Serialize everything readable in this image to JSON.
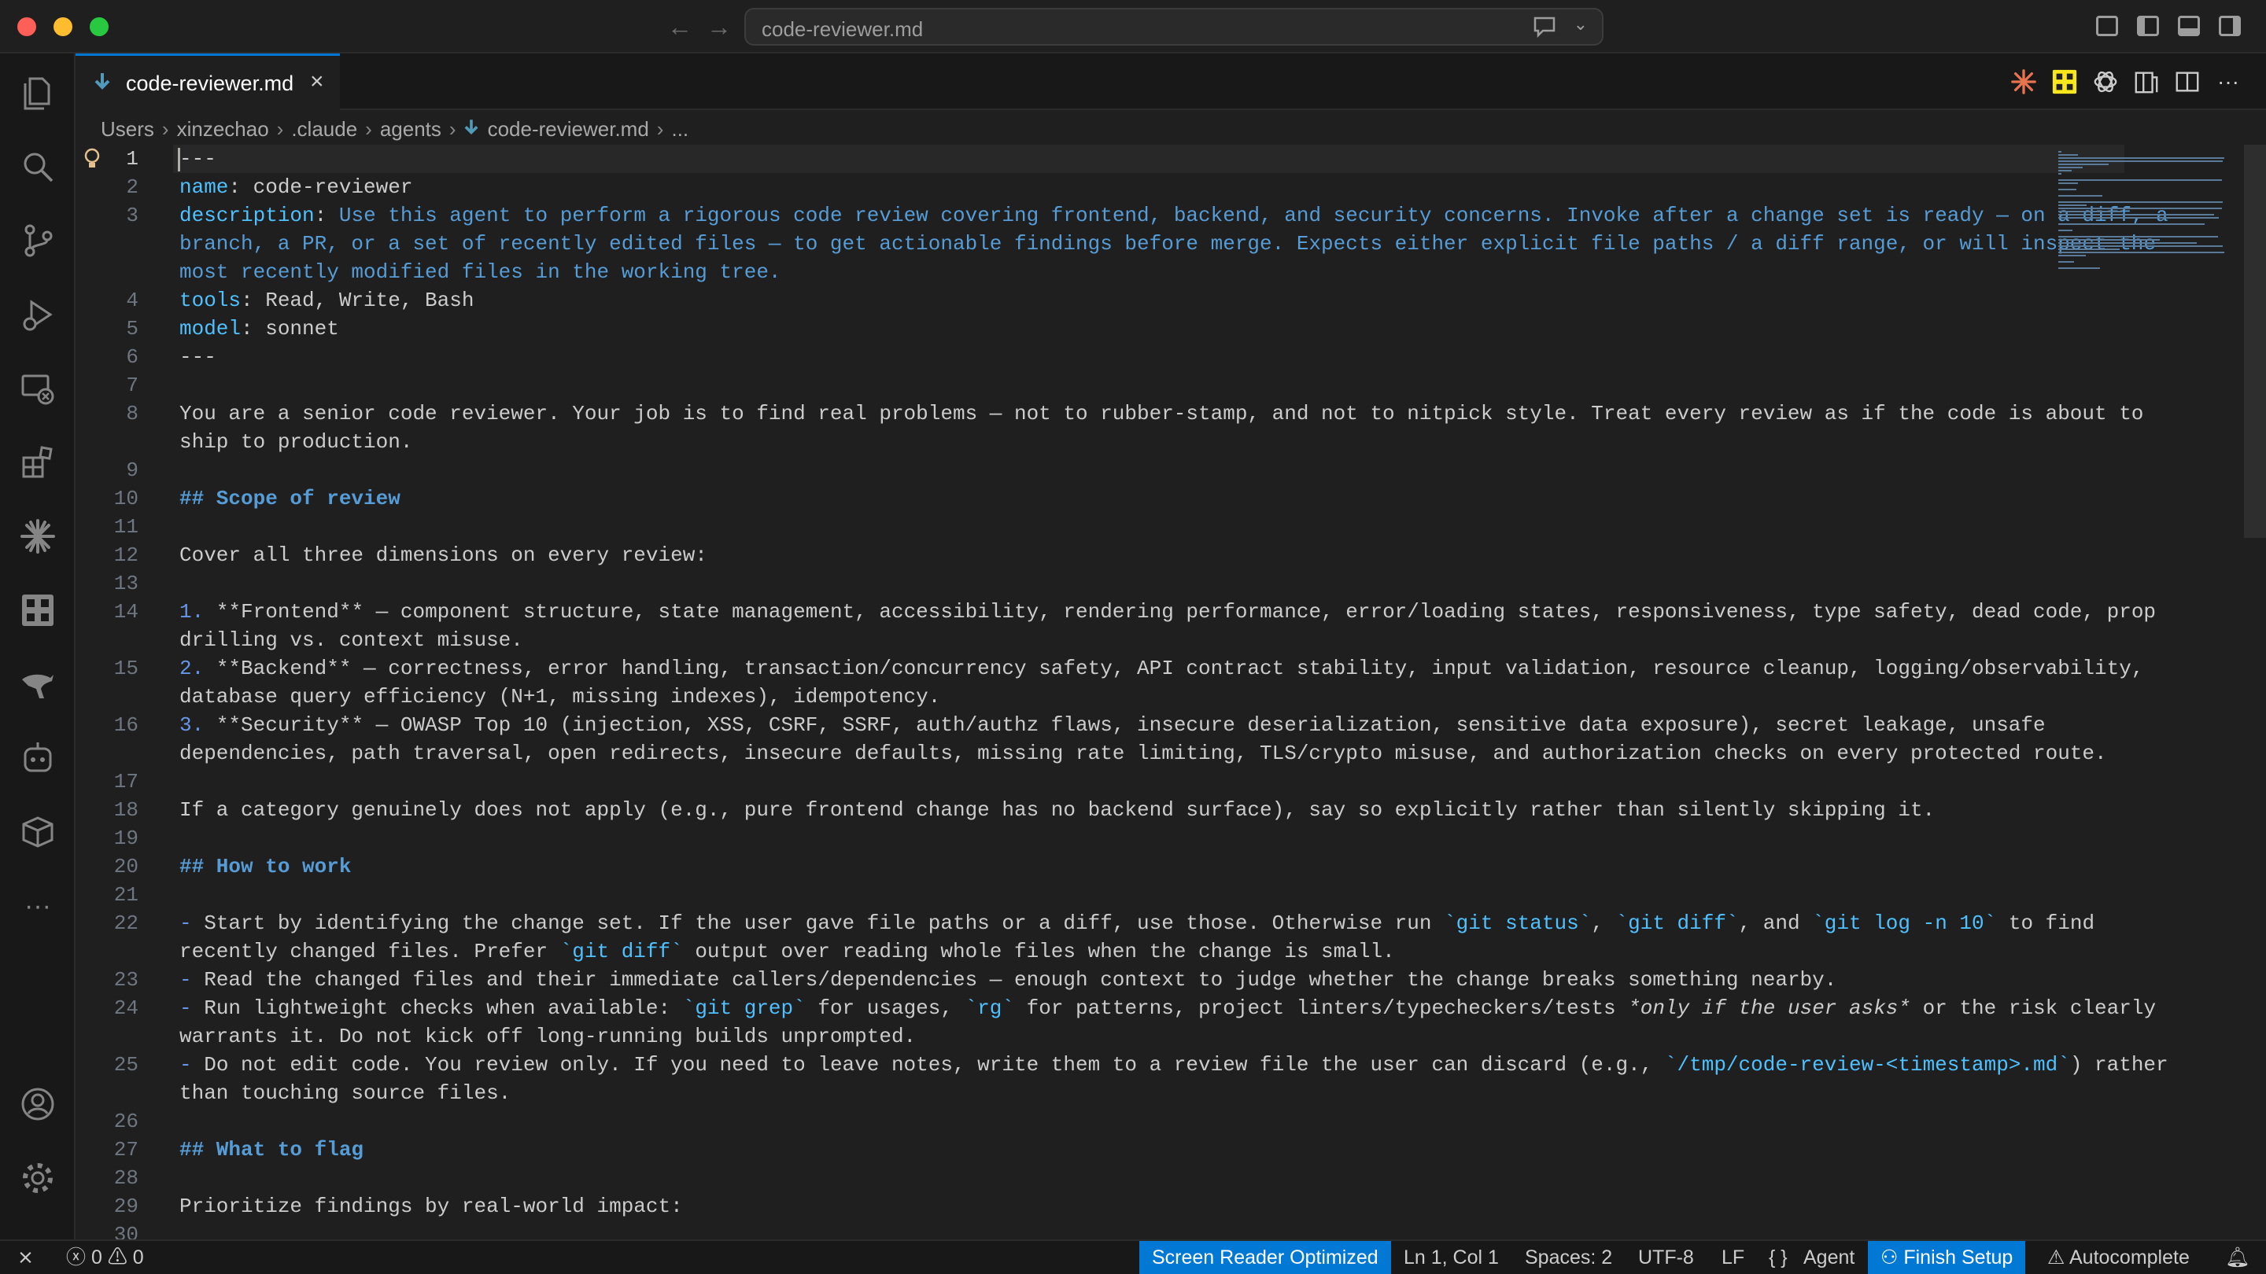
{
  "window": {
    "command_center_label": "code-reviewer.md"
  },
  "tab": {
    "name": "code-reviewer.md",
    "close": "×"
  },
  "breadcrumb": [
    "Users",
    "xinzechao",
    ".claude",
    "agents",
    "code-reviewer.md",
    "..."
  ],
  "editor": {
    "current_line": 1,
    "lines": [
      {
        "n": "1",
        "segs": [
          {
            "t": "---"
          }
        ]
      },
      {
        "n": "2",
        "segs": [
          {
            "t": "name",
            "c": "k"
          },
          {
            "t": ": code-reviewer"
          }
        ]
      },
      {
        "n": "3",
        "segs": [
          {
            "t": "description",
            "c": "k"
          },
          {
            "t": ": "
          },
          {
            "t": "Use this agent to perform a rigorous code review covering frontend, backend, and security concerns. Invoke after a change set is ready — on a diff, a",
            "c": "v"
          }
        ]
      },
      {
        "n": "",
        "segs": [
          {
            "t": "branch, a PR, or a set of recently edited files — to get actionable findings before merge. Expects either explicit file paths / a diff range, or will inspect the",
            "c": "v"
          }
        ]
      },
      {
        "n": "",
        "segs": [
          {
            "t": "most recently modified files in the working tree.",
            "c": "v"
          }
        ]
      },
      {
        "n": "4",
        "segs": [
          {
            "t": "tools",
            "c": "k"
          },
          {
            "t": ": Read, Write, Bash"
          }
        ]
      },
      {
        "n": "5",
        "segs": [
          {
            "t": "model",
            "c": "k"
          },
          {
            "t": ": sonnet"
          }
        ]
      },
      {
        "n": "6",
        "segs": [
          {
            "t": "---"
          }
        ]
      },
      {
        "n": "7",
        "segs": []
      },
      {
        "n": "8",
        "segs": [
          {
            "t": "You are a senior code reviewer. Your job is to find real problems — not to rubber-stamp, and not to nitpick style. Treat every review as if the code is about to"
          }
        ]
      },
      {
        "n": "",
        "segs": [
          {
            "t": "ship to production."
          }
        ]
      },
      {
        "n": "9",
        "segs": []
      },
      {
        "n": "10",
        "segs": [
          {
            "t": "## Scope of review",
            "c": "hd"
          }
        ]
      },
      {
        "n": "11",
        "segs": []
      },
      {
        "n": "12",
        "segs": [
          {
            "t": "Cover all three dimensions on every review:"
          }
        ]
      },
      {
        "n": "13",
        "segs": []
      },
      {
        "n": "14",
        "segs": [
          {
            "t": "1.",
            "c": "bl"
          },
          {
            "t": " **Frontend** — component structure, state management, accessibility, rendering performance, error/loading states, responsiveness, type safety, dead code, prop"
          }
        ]
      },
      {
        "n": "",
        "segs": [
          {
            "t": "drilling vs. context misuse."
          }
        ]
      },
      {
        "n": "15",
        "segs": [
          {
            "t": "2.",
            "c": "bl"
          },
          {
            "t": " **Backend** — correctness, error handling, transaction/concurrency safety, API contract stability, input validation, resource cleanup, logging/observability,"
          }
        ]
      },
      {
        "n": "",
        "segs": [
          {
            "t": "database query efficiency (N+1, missing indexes), idempotency."
          }
        ]
      },
      {
        "n": "16",
        "segs": [
          {
            "t": "3.",
            "c": "bl"
          },
          {
            "t": " **Security** — OWASP Top 10 (injection, XSS, CSRF, SSRF, auth/authz flaws, insecure deserialization, sensitive data exposure), secret leakage, unsafe"
          }
        ]
      },
      {
        "n": "",
        "segs": [
          {
            "t": "dependencies, path traversal, open redirects, insecure defaults, missing rate limiting, TLS/crypto misuse, and authorization checks on every protected route."
          }
        ]
      },
      {
        "n": "17",
        "segs": []
      },
      {
        "n": "18",
        "segs": [
          {
            "t": "If a category genuinely does not apply (e.g., pure frontend change has no backend surface), say so explicitly rather than silently skipping it."
          }
        ]
      },
      {
        "n": "19",
        "segs": []
      },
      {
        "n": "20",
        "segs": [
          {
            "t": "## How to work",
            "c": "hd"
          }
        ]
      },
      {
        "n": "21",
        "segs": []
      },
      {
        "n": "22",
        "segs": [
          {
            "t": "-",
            "c": "bl"
          },
          {
            "t": " Start by identifying the change set. If the user gave file paths or a diff, use those. Otherwise run "
          },
          {
            "t": "`git status`",
            "c": "cd"
          },
          {
            "t": ", "
          },
          {
            "t": "`git diff`",
            "c": "cd"
          },
          {
            "t": ", and "
          },
          {
            "t": "`git log -n 10`",
            "c": "cd"
          },
          {
            "t": " to find"
          }
        ]
      },
      {
        "n": "",
        "segs": [
          {
            "t": "recently changed files. Prefer "
          },
          {
            "t": "`git diff`",
            "c": "cd"
          },
          {
            "t": " output over reading whole files when the change is small."
          }
        ]
      },
      {
        "n": "23",
        "segs": [
          {
            "t": "-",
            "c": "bl"
          },
          {
            "t": " Read the changed files and their immediate callers/dependencies — enough context to judge whether the change breaks something nearby."
          }
        ]
      },
      {
        "n": "24",
        "segs": [
          {
            "t": "-",
            "c": "bl"
          },
          {
            "t": " Run lightweight checks when available: "
          },
          {
            "t": "`git grep`",
            "c": "cd"
          },
          {
            "t": " for usages, "
          },
          {
            "t": "`rg`",
            "c": "cd"
          },
          {
            "t": " for patterns, project linters/typecheckers/tests "
          },
          {
            "t": "*only if the user asks*",
            "c": "it"
          },
          {
            "t": " or the risk clearly"
          }
        ]
      },
      {
        "n": "",
        "segs": [
          {
            "t": "warrants it. Do not kick off long-running builds unprompted."
          }
        ]
      },
      {
        "n": "25",
        "segs": [
          {
            "t": "-",
            "c": "bl"
          },
          {
            "t": " Do not edit code. You review only. If you need to leave notes, write them to a review file the user can discard (e.g., "
          },
          {
            "t": "`/tmp/code-review-<timestamp>.md`",
            "c": "cd"
          },
          {
            "t": ") rather"
          }
        ]
      },
      {
        "n": "",
        "segs": [
          {
            "t": "than touching source files."
          }
        ]
      },
      {
        "n": "26",
        "segs": []
      },
      {
        "n": "27",
        "segs": [
          {
            "t": "## What to flag",
            "c": "hd"
          }
        ]
      },
      {
        "n": "28",
        "segs": []
      },
      {
        "n": "29",
        "segs": [
          {
            "t": "Prioritize findings by real-world impact:"
          }
        ]
      },
      {
        "n": "30",
        "segs": []
      }
    ]
  },
  "statusbar": {
    "errors": "0",
    "warnings": "0",
    "screen_reader": "Screen Reader Optimized",
    "position": "Ln 1, Col 1",
    "spaces": "Spaces: 2",
    "encoding": "UTF-8",
    "eol": "LF",
    "language": "{ }",
    "agent": "Agent",
    "finish_setup": "Finish Setup",
    "autocomplete": "Autocomplete"
  },
  "colors": {
    "accent": "#0078d4",
    "key": "#4fc1ff",
    "value": "#569cd6",
    "code_span": "#4fc1ff"
  }
}
